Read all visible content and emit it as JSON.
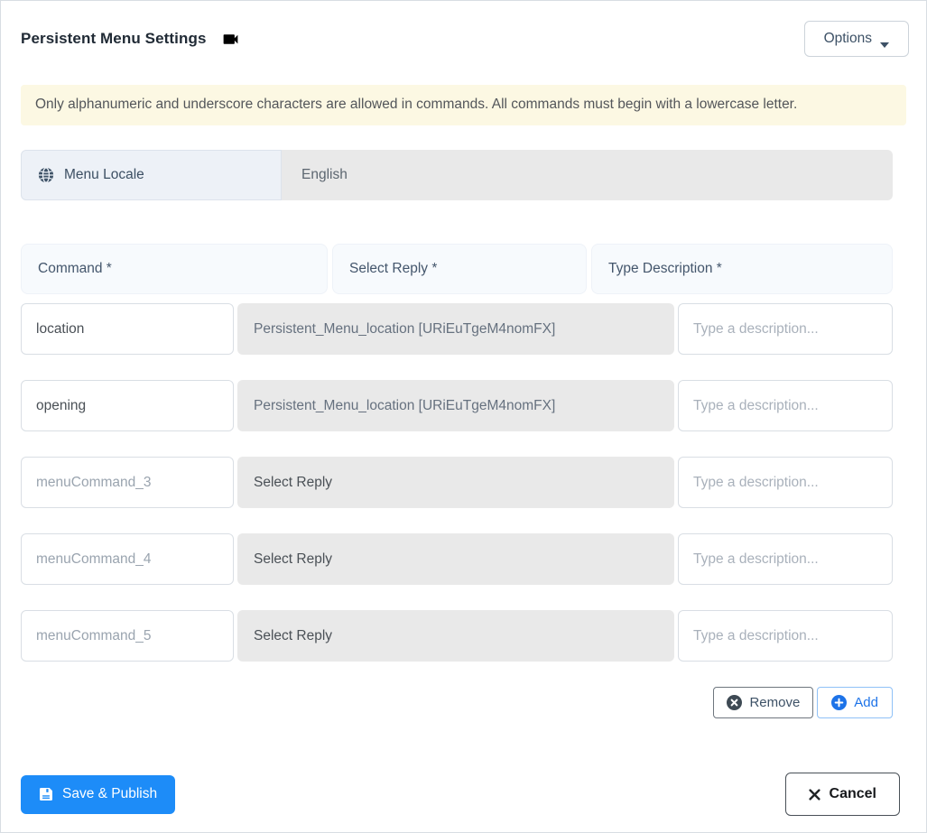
{
  "panel": {
    "title": "Persistent Menu Settings"
  },
  "header": {
    "options_button": "Options"
  },
  "alert": {
    "message": "Only alphanumeric and underscore characters are allowed in commands. All commands must begin with a lowercase letter."
  },
  "locale": {
    "label": "Menu Locale",
    "value": "English"
  },
  "menu_table": {
    "headers": {
      "command": "Command *",
      "reply": "Select Reply *",
      "description": "Type Description *"
    },
    "rows": [
      {
        "command": "location",
        "reply": "Persistent_Menu_location [URiEuTgeM4nomFX]",
        "description_placeholder": "Type a description..."
      },
      {
        "command": "opening",
        "reply": "Persistent_Menu_location [URiEuTgeM4nomFX]",
        "description_placeholder": "Type a description..."
      },
      {
        "command_placeholder": "menuCommand_3",
        "reply": "Select Reply",
        "description_placeholder": "Type a description..."
      },
      {
        "command_placeholder": "menuCommand_4",
        "reply": "Select Reply",
        "description_placeholder": "Type a description..."
      },
      {
        "command_placeholder": "menuCommand_5",
        "reply": "Select Reply",
        "description_placeholder": "Type a description..."
      }
    ],
    "actions": {
      "remove": "Remove",
      "add": "Add"
    }
  },
  "footer": {
    "save": "Save & Publish",
    "cancel": "Cancel"
  },
  "icons": {
    "title": "videocam-icon",
    "options": "caret-down-icon",
    "locale": "globe-icon",
    "remove": "x-circle-icon",
    "add": "plus-circle-icon",
    "save": "save-floppy-icon",
    "cancel": "x-icon"
  },
  "colors": {
    "primary_blue": "#1d8cf8",
    "add_blue": "#1d73e8",
    "warning_bg": "#fcf8e3",
    "disabled_field_bg": "#e9e9e9",
    "locale_label_bg": "#edf1f7",
    "table_header_bg": "#f7fafd",
    "slate_text": "#3d5166"
  }
}
